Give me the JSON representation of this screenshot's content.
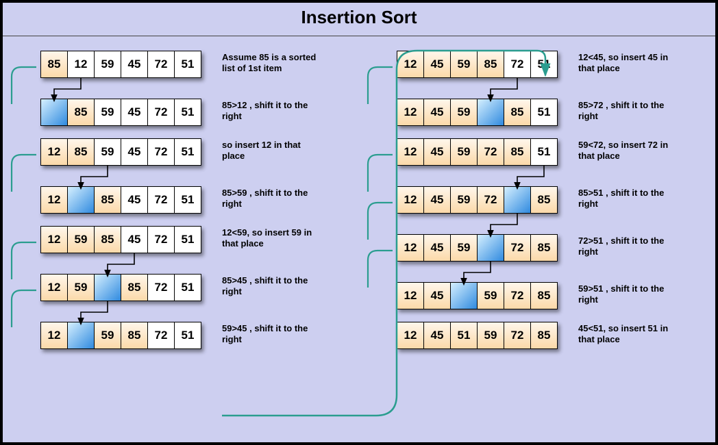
{
  "title": "Insertion  Sort",
  "colors": {
    "sorted": "#fbd9a9",
    "active": "#2f8adf",
    "teal": "#2a9d8f"
  },
  "left_steps": [
    {
      "cells": [
        {
          "v": "85",
          "c": "sorted"
        },
        {
          "v": "12"
        },
        {
          "v": "59"
        },
        {
          "v": "45"
        },
        {
          "v": "72"
        },
        {
          "v": "51"
        }
      ],
      "desc": "Assume 85 is a sorted list of 1st item",
      "loop": true,
      "arrow": {
        "from": 1,
        "to": 0
      },
      "tight": false
    },
    {
      "cells": [
        {
          "v": "",
          "c": "blue"
        },
        {
          "v": "85",
          "c": "sorted"
        },
        {
          "v": "59"
        },
        {
          "v": "45"
        },
        {
          "v": "72"
        },
        {
          "v": "51"
        }
      ],
      "desc": "85>12 , shift it to the right",
      "tight": true
    },
    {
      "cells": [
        {
          "v": "12",
          "c": "sorted"
        },
        {
          "v": "85",
          "c": "sorted"
        },
        {
          "v": "59"
        },
        {
          "v": "45"
        },
        {
          "v": "72"
        },
        {
          "v": "51"
        }
      ],
      "desc": "so insert 12 in that place",
      "loop": true,
      "arrow": {
        "from": 2,
        "to": 1
      },
      "tight": false
    },
    {
      "cells": [
        {
          "v": "12",
          "c": "sorted"
        },
        {
          "v": "",
          "c": "blue"
        },
        {
          "v": "85",
          "c": "sorted"
        },
        {
          "v": "45"
        },
        {
          "v": "72"
        },
        {
          "v": "51"
        }
      ],
      "desc": "85>59 , shift it to the right",
      "tight": true
    },
    {
      "cells": [
        {
          "v": "12",
          "c": "sorted"
        },
        {
          "v": "59",
          "c": "sorted"
        },
        {
          "v": "85",
          "c": "sorted"
        },
        {
          "v": "45"
        },
        {
          "v": "72"
        },
        {
          "v": "51"
        }
      ],
      "desc": "12<59, so insert 59 in that place",
      "loop": true,
      "arrow": {
        "from": 3,
        "to": 2
      },
      "tight": false
    },
    {
      "cells": [
        {
          "v": "12",
          "c": "sorted"
        },
        {
          "v": "59",
          "c": "sorted"
        },
        {
          "v": "",
          "c": "blue"
        },
        {
          "v": "85",
          "c": "sorted"
        },
        {
          "v": "72"
        },
        {
          "v": "51"
        }
      ],
      "desc": "85>45 , shift it to the right",
      "loop": true,
      "arrow": {
        "from": 2,
        "to": 1
      },
      "tight": false
    },
    {
      "cells": [
        {
          "v": "12",
          "c": "sorted"
        },
        {
          "v": "",
          "c": "blue"
        },
        {
          "v": "59",
          "c": "sorted"
        },
        {
          "v": "85",
          "c": "sorted"
        },
        {
          "v": "72"
        },
        {
          "v": "51"
        }
      ],
      "desc": "59>45 , shift it to the right",
      "tight": false
    }
  ],
  "right_steps": [
    {
      "cells": [
        {
          "v": "12",
          "c": "sorted"
        },
        {
          "v": "45",
          "c": "sorted"
        },
        {
          "v": "59",
          "c": "sorted"
        },
        {
          "v": "85",
          "c": "sorted"
        },
        {
          "v": "72"
        },
        {
          "v": "51"
        }
      ],
      "desc": "12<45, so insert 45 in that place",
      "loop": true,
      "arrow": {
        "from": 4,
        "to": 3
      },
      "tight": false
    },
    {
      "cells": [
        {
          "v": "12",
          "c": "sorted"
        },
        {
          "v": "45",
          "c": "sorted"
        },
        {
          "v": "59",
          "c": "sorted"
        },
        {
          "v": "",
          "c": "blue"
        },
        {
          "v": "85",
          "c": "sorted"
        },
        {
          "v": "51"
        }
      ],
      "desc": "85>72 , shift it to the right",
      "tight": true
    },
    {
      "cells": [
        {
          "v": "12",
          "c": "sorted"
        },
        {
          "v": "45",
          "c": "sorted"
        },
        {
          "v": "59",
          "c": "sorted"
        },
        {
          "v": "72",
          "c": "sorted"
        },
        {
          "v": "85",
          "c": "sorted"
        },
        {
          "v": "51"
        }
      ],
      "desc": "59<72, so insert 72 in that place",
      "loop": true,
      "arrow": {
        "from": 5,
        "to": 4
      },
      "tight": false
    },
    {
      "cells": [
        {
          "v": "12",
          "c": "sorted"
        },
        {
          "v": "45",
          "c": "sorted"
        },
        {
          "v": "59",
          "c": "sorted"
        },
        {
          "v": "72",
          "c": "sorted"
        },
        {
          "v": "",
          "c": "blue"
        },
        {
          "v": "85",
          "c": "sorted"
        }
      ],
      "desc": "85>51 , shift it to the right",
      "loop": true,
      "arrow": {
        "from": 4,
        "to": 3
      },
      "tight": false
    },
    {
      "cells": [
        {
          "v": "12",
          "c": "sorted"
        },
        {
          "v": "45",
          "c": "sorted"
        },
        {
          "v": "59",
          "c": "sorted"
        },
        {
          "v": "",
          "c": "blue"
        },
        {
          "v": "72",
          "c": "sorted"
        },
        {
          "v": "85",
          "c": "sorted"
        }
      ],
      "desc": "72>51 , shift it to the right",
      "loop": true,
      "arrow": {
        "from": 3,
        "to": 2
      },
      "tight": false
    },
    {
      "cells": [
        {
          "v": "12",
          "c": "sorted"
        },
        {
          "v": "45",
          "c": "sorted"
        },
        {
          "v": "",
          "c": "blue"
        },
        {
          "v": "59",
          "c": "sorted"
        },
        {
          "v": "72",
          "c": "sorted"
        },
        {
          "v": "85",
          "c": "sorted"
        }
      ],
      "desc": "59>51 , shift it to the right",
      "tight": true
    },
    {
      "cells": [
        {
          "v": "12",
          "c": "sorted"
        },
        {
          "v": "45",
          "c": "sorted"
        },
        {
          "v": "51",
          "c": "sorted"
        },
        {
          "v": "59",
          "c": "sorted"
        },
        {
          "v": "72",
          "c": "sorted"
        },
        {
          "v": "85",
          "c": "sorted"
        }
      ],
      "desc": "45<51, so insert 51 in that place",
      "tight": false
    }
  ]
}
